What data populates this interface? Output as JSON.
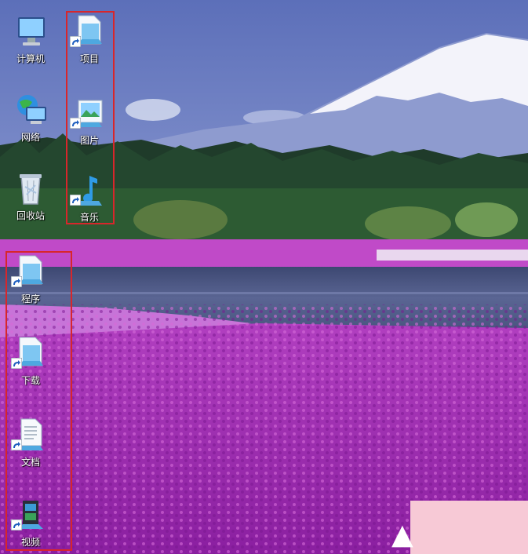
{
  "desktop": {
    "icons": [
      {
        "name": "计算机",
        "kind": "computer",
        "shortcut": false
      },
      {
        "name": "网络",
        "kind": "network",
        "shortcut": false
      },
      {
        "name": "回收站",
        "kind": "recycle-bin",
        "shortcut": false
      },
      {
        "name": "项目",
        "kind": "folder",
        "shortcut": true
      },
      {
        "name": "图片",
        "kind": "pictures",
        "shortcut": true
      },
      {
        "name": "音乐",
        "kind": "music",
        "shortcut": true
      },
      {
        "name": "程序",
        "kind": "folder",
        "shortcut": true
      },
      {
        "name": "下载",
        "kind": "folder",
        "shortcut": true
      },
      {
        "name": "文档",
        "kind": "documents",
        "shortcut": true
      },
      {
        "name": "视频",
        "kind": "videos",
        "shortcut": true
      }
    ],
    "wallpaper": "Mount Fuji with pink moss phlox field and lake",
    "highlight_color": "#d8262b"
  }
}
